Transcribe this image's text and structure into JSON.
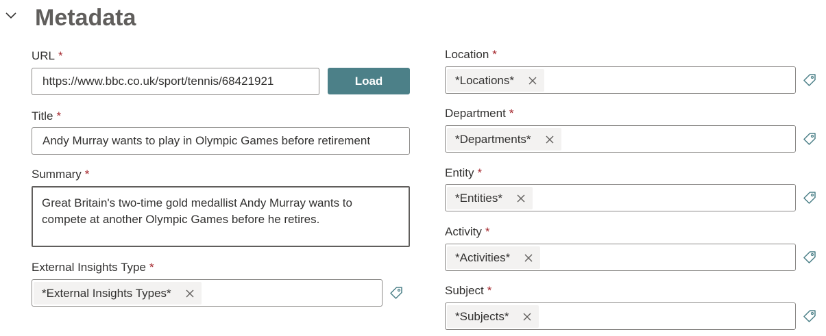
{
  "section": {
    "title": "Metadata"
  },
  "required_marker": "*",
  "url": {
    "label": "URL",
    "value": "https://www.bbc.co.uk/sport/tennis/68421921",
    "load_label": "Load"
  },
  "title_field": {
    "label": "Title",
    "value": "Andy Murray wants to play in Olympic Games before retirement"
  },
  "summary": {
    "label": "Summary",
    "lines": [
      "Great Britain's two-time gold medallist Andy Murray wants to",
      "compete at another Olympic Games before he retires."
    ]
  },
  "external_insights_type": {
    "label": "External Insights Type",
    "tag": "*External Insights Types*"
  },
  "location": {
    "label": "Location",
    "tag": "*Locations*"
  },
  "department": {
    "label": "Department",
    "tag": "*Departments*"
  },
  "entity": {
    "label": "Entity",
    "tag": "*Entities*"
  },
  "activity": {
    "label": "Activity",
    "tag": "*Activities*"
  },
  "subject": {
    "label": "Subject",
    "tag": "*Subjects*"
  },
  "icons": {
    "collapse": "chevron-down-icon",
    "remove": "close-icon",
    "tag": "tag-icon"
  },
  "colors": {
    "accent": "#4c8088",
    "required": "#a4262c",
    "heading": "#605e5c",
    "pill": "#f3f2f1"
  }
}
